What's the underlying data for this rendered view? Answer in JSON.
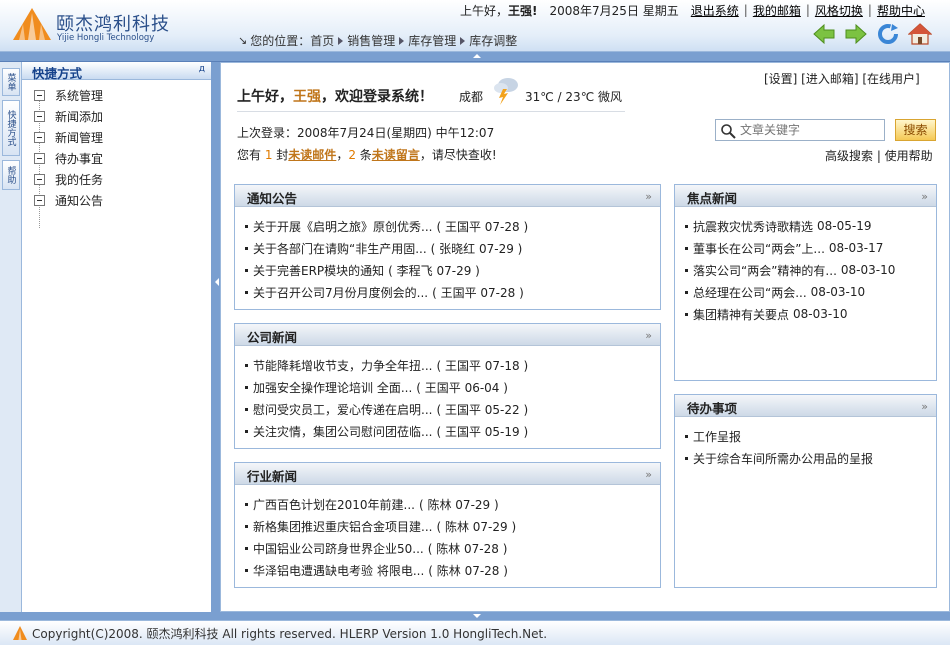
{
  "header": {
    "logo_cn": "颐杰鸿利科技",
    "logo_en": "Yijie Hongli Technology",
    "greeting_prefix": "上午好，",
    "user": "王强!",
    "date": "2008年7月25日 星期五",
    "links": [
      "退出系统",
      "我的邮箱",
      "风格切换",
      "帮助中心"
    ],
    "crumb_label": "您的位置：",
    "breadcrumb": [
      "首页",
      "销售管理",
      "库存管理",
      "库存调整"
    ],
    "nav_icons": [
      "back-arrow-icon",
      "forward-arrow-icon",
      "refresh-icon",
      "home-icon"
    ]
  },
  "left_tabs": [
    "菜单",
    "快捷方式",
    "帮助"
  ],
  "sidebar": {
    "title": "快捷方式",
    "pin": "д",
    "items": [
      "系统管理",
      "新闻添加",
      "新闻管理",
      "待办事宜",
      "我的任务",
      "通知公告"
    ]
  },
  "main": {
    "welcome_prefix": "上午好，",
    "welcome_user": "王强",
    "welcome_suffix": "，欢迎登录系统！",
    "city": "成都",
    "weather": "31℃ / 23℃ 微风",
    "top_links": "[设置] [进入邮箱] [在线用户]",
    "last_login": "上次登录：2008年7月24日(星期四) 中午12:07",
    "unread": {
      "p1": "您有 ",
      "mail_count": "1",
      "p2": " 封",
      "mail_link": "未读邮件",
      "p3": "，",
      "msg_count": "2",
      "p4": " 条",
      "msg_link": "未读留言",
      "p5": "，请尽快查收!"
    },
    "search": {
      "placeholder": "文章关键字",
      "button": "搜索"
    },
    "help_links": "高级搜索 | 使用帮助"
  },
  "panels": {
    "notice": {
      "title": "通知公告",
      "more": "»",
      "items": [
        {
          "text": "关于开展《启明之旅》原创优秀...",
          "meta": "( 王国平 07-28 )"
        },
        {
          "text": "关于各部门在请购“非生产用固...",
          "meta": "( 张晓红 07-29 )"
        },
        {
          "text": "关于完善ERP模块的通知",
          "meta": "( 李程飞 07-29 )"
        },
        {
          "text": "关于召开公司7月份月度例会的...",
          "meta": "( 王国平 07-28 )"
        }
      ]
    },
    "company": {
      "title": "公司新闻",
      "more": "»",
      "items": [
        {
          "text": "节能降耗增收节支，力争全年扭...",
          "meta": "( 王国平 07-18 )"
        },
        {
          "text": "加强安全操作理论培训 全面...",
          "meta": "( 王国平 06-04 )"
        },
        {
          "text": "慰问受灾员工，爱心传递在启明...",
          "meta": "( 王国平 05-22 )"
        },
        {
          "text": "关注灾情，集团公司慰问团莅临...",
          "meta": "( 王国平 05-19 )"
        }
      ]
    },
    "industry": {
      "title": "行业新闻",
      "more": "»",
      "items": [
        {
          "text": "广西百色计划在2010年前建...",
          "meta": "( 陈林 07-29 )"
        },
        {
          "text": "新格集团推迟重庆铝合金项目建...",
          "meta": "( 陈林 07-29 )"
        },
        {
          "text": "中国铝业公司跻身世界企业50...",
          "meta": "( 陈林 07-28 )"
        },
        {
          "text": "华泽铝电遭遇缺电考验 将限电...",
          "meta": "( 陈林 07-28 )"
        }
      ]
    },
    "focus": {
      "title": "焦点新闻",
      "more": "»",
      "items": [
        {
          "text": "抗震救灾忧秀诗歌精选",
          "meta": "08-05-19"
        },
        {
          "text": "董事长在公司“两会”上...",
          "meta": "08-03-17"
        },
        {
          "text": "落实公司“两会”精神的有...",
          "meta": "08-03-10"
        },
        {
          "text": "总经理在公司“两会...",
          "meta": "08-03-10"
        },
        {
          "text": "集团精神有关要点",
          "meta": "08-03-10"
        }
      ]
    },
    "todo": {
      "title": "待办事项",
      "more": "»",
      "items": [
        {
          "text": "工作呈报",
          "meta": ""
        },
        {
          "text": "关于综合车间所需办公用品的呈报",
          "meta": ""
        }
      ]
    }
  },
  "footer": {
    "text": "Copyright(C)2008. 颐杰鸿利科技 All rights reserved. HLERP Version 1.0 HongliTech.Net."
  },
  "colors": {
    "brand": "#2a4f8a",
    "frame": "#7a9fd0",
    "accent": "#c0761b",
    "logo_orange": "#f08c1e"
  }
}
